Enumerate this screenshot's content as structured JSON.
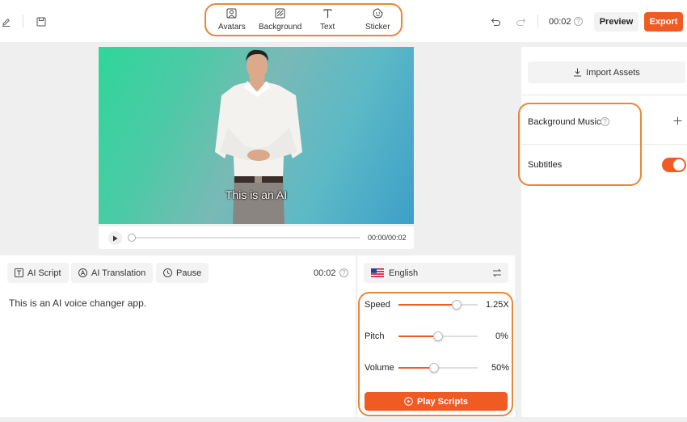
{
  "toolbar": {
    "tools": [
      {
        "label": "Avatars",
        "icon": "avatar-icon"
      },
      {
        "label": "Background",
        "icon": "background-icon"
      },
      {
        "label": "Text",
        "icon": "text-icon"
      },
      {
        "label": "Sticker",
        "icon": "sticker-icon"
      }
    ],
    "duration": "00:02",
    "preview_label": "Preview",
    "export_label": "Export",
    "accent_color": "#f05a23"
  },
  "player": {
    "subtitle_text": "This is an AI",
    "time": "00:00/00:02",
    "progress": 0
  },
  "script_panel": {
    "tabs": [
      {
        "label": "AI Script",
        "icon": "script-icon"
      },
      {
        "label": "AI Translation",
        "icon": "translate-icon"
      },
      {
        "label": "Pause",
        "icon": "clock-icon"
      }
    ],
    "duration": "00:02",
    "script_text": "This is an AI voice changer app."
  },
  "voice_panel": {
    "language": "English",
    "speed": {
      "label": "Speed",
      "value": "1.25X",
      "level": 0.72
    },
    "pitch": {
      "label": "Pitch",
      "value": "0%",
      "level": 0.5
    },
    "volume": {
      "label": "Volume",
      "value": "50%",
      "level": 0.45
    },
    "play_label": "Play Scripts"
  },
  "right_panel": {
    "import_label": "Import Assets",
    "background_music_label": "Background Music",
    "subtitles_label": "Subtitles",
    "subtitles_enabled": true
  }
}
